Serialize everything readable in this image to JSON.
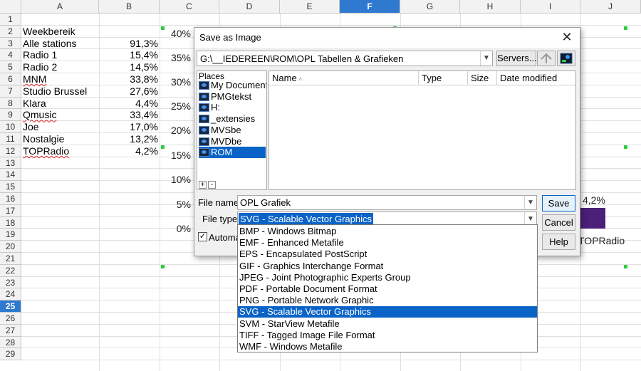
{
  "sheet": {
    "columns": [
      "A",
      "B",
      "C",
      "D",
      "E",
      "F",
      "G",
      "H",
      "I",
      "J"
    ],
    "selected_column": "F",
    "rows": [
      "1",
      "2",
      "3",
      "4",
      "5",
      "6",
      "7",
      "8",
      "9",
      "10",
      "11",
      "12",
      "13",
      "14",
      "15",
      "16",
      "17",
      "18",
      "19",
      "20",
      "21",
      "22",
      "23",
      "24",
      "25",
      "26",
      "27",
      "28",
      "29"
    ],
    "selected_row": "25",
    "data": [
      {
        "label": "Weekbereik",
        "value": ""
      },
      {
        "label": "Alle stations",
        "value": "91,3%"
      },
      {
        "label": "Radio 1",
        "value": "15,4%"
      },
      {
        "label": "Radio 2",
        "value": "14,5%"
      },
      {
        "label": "MNM",
        "value": "33,8%"
      },
      {
        "label": "Studio Brussel",
        "value": "27,6%"
      },
      {
        "label": "Klara",
        "value": "4,4%"
      },
      {
        "label": "Qmusic",
        "value": "33,4%"
      },
      {
        "label": "Joe",
        "value": "17,0%"
      },
      {
        "label": "Nostalgie",
        "value": "13,2%"
      },
      {
        "label": "TOPRadio",
        "value": "4,2%"
      }
    ]
  },
  "chart": {
    "y_ticks": [
      "40%",
      "35%",
      "30%",
      "25%",
      "20%",
      "15%",
      "10%",
      "5%",
      "0%"
    ],
    "visible_label": "4,2%",
    "visible_category": "TOPRadio",
    "bar_color": "#4b1f7a"
  },
  "dialog": {
    "title": "Save as Image",
    "path": "G:\\__IEDEREEN\\ROM\\OPL Tabellen & Grafieken",
    "servers_label": "Servers...",
    "places_header": "Places",
    "places": [
      "My Documents",
      "PMGtekst",
      "H:",
      "_extensies",
      "MVSbe",
      "MVDbe",
      "ROM"
    ],
    "selected_place": "ROM",
    "columns": {
      "name": "Name",
      "type": "Type",
      "size": "Size",
      "date": "Date modified"
    },
    "file_name_label": "File name:",
    "file_name_value": "OPL Grafiek",
    "file_type_label": "File type:",
    "file_type_value": "SVG - Scalable Vector Graphics",
    "auto_ext_label": "Automa",
    "auto_ext_checked": true,
    "save_label": "Save",
    "cancel_label": "Cancel",
    "help_label": "Help",
    "add_symbol": "+",
    "remove_symbol": "-"
  },
  "file_types": [
    "BMP - Windows Bitmap",
    "EMF - Enhanced Metafile",
    "EPS - Encapsulated PostScript",
    "GIF - Graphics Interchange Format",
    "JPEG - Joint Photographic Experts Group",
    "PDF - Portable Document Format",
    "PNG - Portable Network Graphic",
    "SVG - Scalable Vector Graphics",
    "SVM - StarView Metafile",
    "TIFF - Tagged Image File Format",
    "WMF - Windows Metafile"
  ],
  "selected_file_type": "SVG - Scalable Vector Graphics"
}
